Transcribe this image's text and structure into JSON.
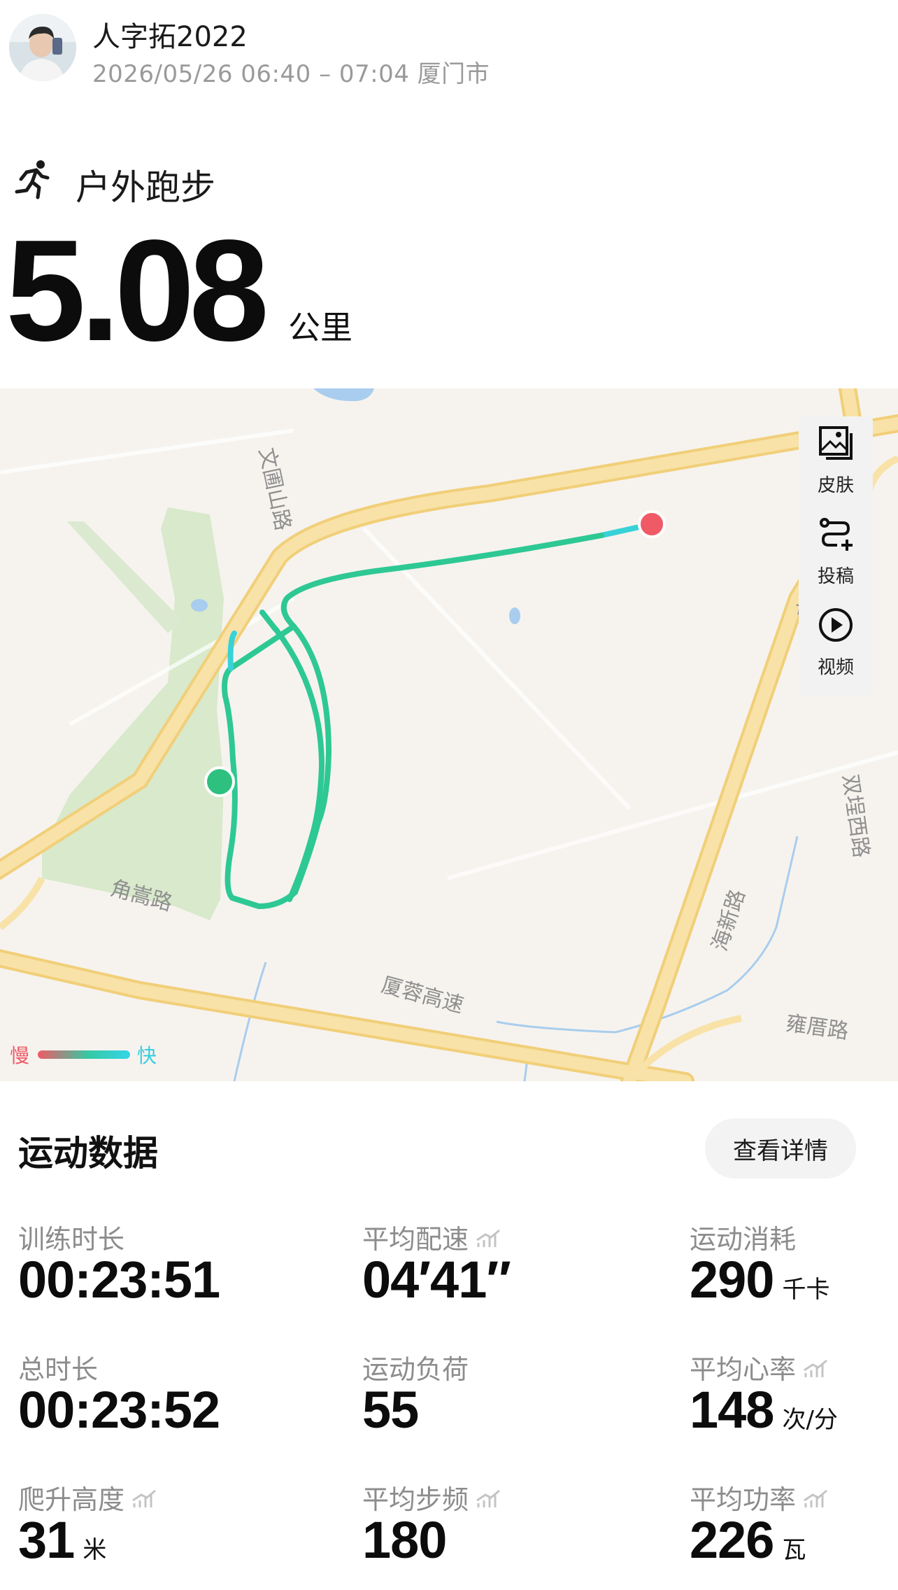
{
  "header": {
    "username": "人字拓2022",
    "datetime_location": "2026/05/26 06:40 – 07:04 厦门市"
  },
  "activity": {
    "type_icon": "running-person-icon",
    "type_label": "户外跑步",
    "distance": "5.08",
    "distance_unit": "公里"
  },
  "map": {
    "tools": [
      {
        "label": "皮肤",
        "icon": "image-skin-icon"
      },
      {
        "label": "投稿",
        "icon": "route-submit-icon"
      },
      {
        "label": "视频",
        "icon": "play-video-icon"
      }
    ],
    "legend": {
      "slow": "慢",
      "fast": "快"
    },
    "road_labels": {
      "wenpu": "文圃山路",
      "jiaogao": "角嵩路",
      "xiarong": "厦蓉高速",
      "haixin": "海新路",
      "xinglin": "杏林东路",
      "shuangli": "双埕西路",
      "yongcuo": "雍厝路"
    },
    "colors": {
      "route": "#2ec894",
      "start": "#2ec07f",
      "end": "#f05a66",
      "road": "#f6d98a",
      "park": "#d8e9cc",
      "water": "#a9cdee"
    }
  },
  "stats": {
    "title": "运动数据",
    "details_button": "查看详情",
    "items": [
      {
        "label": "训练时长",
        "value": "00:23:51",
        "unit": ""
      },
      {
        "label": "平均配速",
        "value": "04′41″",
        "unit": ""
      },
      {
        "label": "运动消耗",
        "value": "290",
        "unit": "千卡"
      },
      {
        "label": "总时长",
        "value": "00:23:52",
        "unit": ""
      },
      {
        "label": "运动负荷",
        "value": "55",
        "unit": ""
      },
      {
        "label": "平均心率",
        "value": "148",
        "unit": "次/分"
      },
      {
        "label": "爬升高度",
        "value": "31",
        "unit": "米"
      },
      {
        "label": "平均步频",
        "value": "180",
        "unit": ""
      },
      {
        "label": "平均功率",
        "value": "226",
        "unit": "瓦"
      }
    ]
  }
}
